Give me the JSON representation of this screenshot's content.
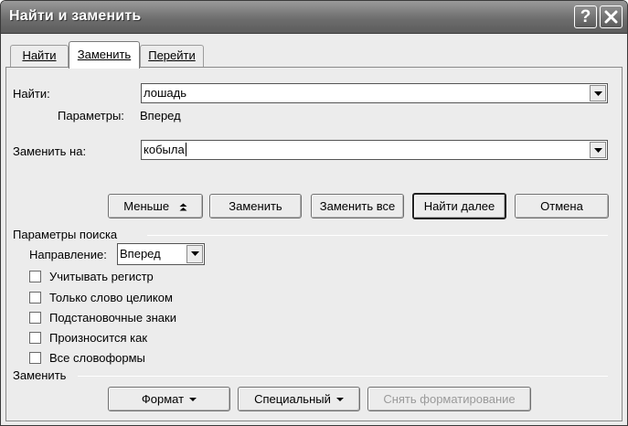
{
  "window": {
    "title": "Найти и заменить",
    "help_glyph": "?",
    "close_icon": "close-x-icon"
  },
  "tabs": [
    {
      "label": "Найти",
      "active": false
    },
    {
      "label": "Заменить",
      "active": true
    },
    {
      "label": "Перейти",
      "active": false
    }
  ],
  "find": {
    "label": "Найти:",
    "value": "лошадь",
    "options_label": "Параметры:",
    "options_value": "Вперед"
  },
  "replace": {
    "label": "Заменить на:",
    "value": "кобыла"
  },
  "buttons": {
    "less": "Меньше",
    "replace": "Заменить",
    "replace_all": "Заменить все",
    "find_next": "Найти далее",
    "cancel": "Отмена"
  },
  "search_params": {
    "heading": "Параметры поиска",
    "direction_label": "Направление:",
    "direction_value": "Вперед",
    "checkboxes": [
      {
        "label": "Учитывать регистр",
        "checked": false
      },
      {
        "label": "Только слово целиком",
        "checked": false
      },
      {
        "label": "Подстановочные знаки",
        "checked": false
      },
      {
        "label": "Произносится как",
        "checked": false
      },
      {
        "label": "Все словоформы",
        "checked": false
      }
    ]
  },
  "replace_section": {
    "heading": "Заменить",
    "format": "Формат",
    "special": "Специальный",
    "clear_formatting": "Снять форматирование"
  }
}
